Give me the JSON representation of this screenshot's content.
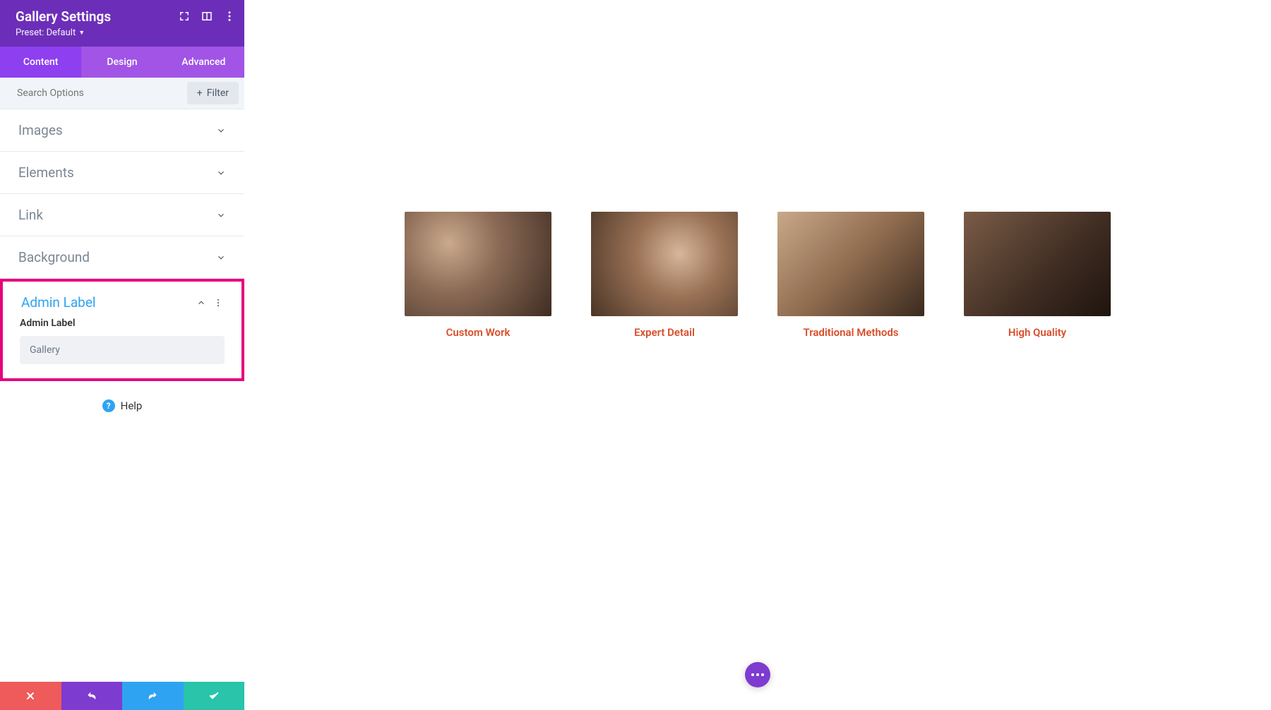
{
  "header": {
    "title": "Gallery Settings",
    "preset_label": "Preset: Default"
  },
  "tabs": {
    "content": "Content",
    "design": "Design",
    "advanced": "Advanced"
  },
  "search": {
    "placeholder": "Search Options",
    "filter_label": "Filter"
  },
  "sections": {
    "images": "Images",
    "elements": "Elements",
    "link": "Link",
    "background": "Background",
    "admin_label": "Admin Label"
  },
  "admin_label": {
    "field_label": "Admin Label",
    "value": "Gallery"
  },
  "help_label": "Help",
  "gallery": [
    {
      "caption": "Custom Work"
    },
    {
      "caption": "Expert Detail"
    },
    {
      "caption": "Traditional Methods"
    },
    {
      "caption": "High Quality"
    }
  ]
}
